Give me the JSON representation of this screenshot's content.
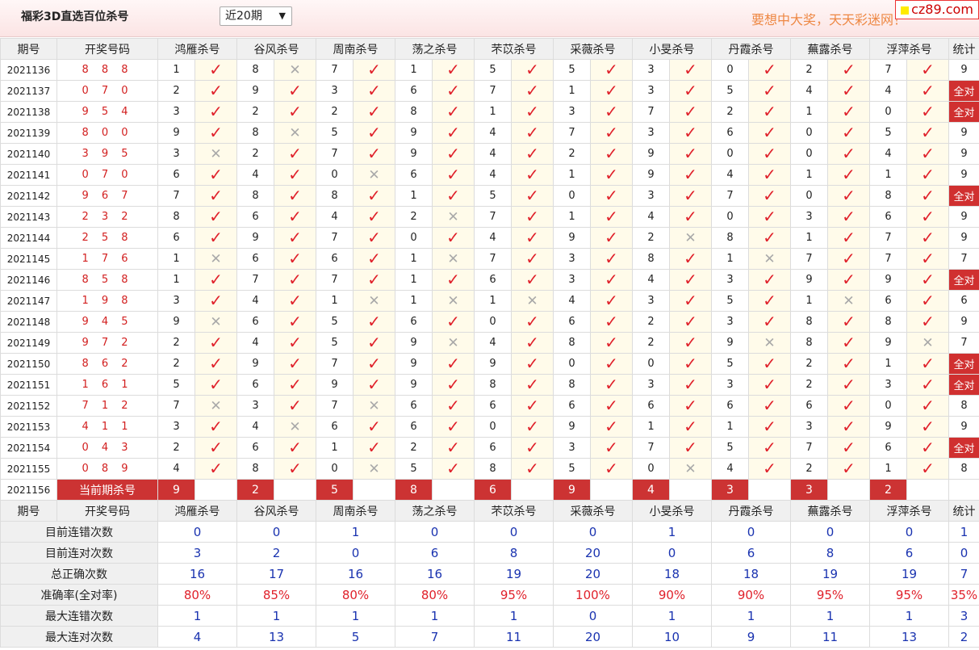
{
  "header": {
    "title": "福彩3D直选百位杀号",
    "period_select": "近20期",
    "slogan": "要想中大奖，天天彩迷网！",
    "logo": "cz89.com"
  },
  "columns": {
    "issue": "期号",
    "numbers": "开奖号码",
    "experts": [
      "鸿雁杀号",
      "谷风杀号",
      "周南杀号",
      "荡之杀号",
      "芣苡杀号",
      "采薇杀号",
      "小旻杀号",
      "丹霞杀号",
      "蕪露杀号",
      "浮萍杀号"
    ],
    "stat": "统计"
  },
  "rows": [
    {
      "issue": "2021136",
      "numbers": "8 8 8",
      "kills": [
        "1",
        "8",
        "7",
        "1",
        "5",
        "5",
        "3",
        "0",
        "2",
        "7"
      ],
      "results": [
        "ok",
        "x",
        "ok",
        "ok",
        "ok",
        "ok",
        "ok",
        "ok",
        "ok",
        "ok"
      ],
      "stat": "9"
    },
    {
      "issue": "2021137",
      "numbers": "0 7 0",
      "kills": [
        "2",
        "9",
        "3",
        "6",
        "7",
        "1",
        "3",
        "5",
        "4",
        "4"
      ],
      "results": [
        "ok",
        "ok",
        "ok",
        "ok",
        "ok",
        "ok",
        "ok",
        "ok",
        "ok",
        "ok"
      ],
      "stat": "全对"
    },
    {
      "issue": "2021138",
      "numbers": "9 5 4",
      "kills": [
        "3",
        "2",
        "2",
        "8",
        "1",
        "3",
        "7",
        "2",
        "1",
        "0"
      ],
      "results": [
        "ok",
        "ok",
        "ok",
        "ok",
        "ok",
        "ok",
        "ok",
        "ok",
        "ok",
        "ok"
      ],
      "stat": "全对"
    },
    {
      "issue": "2021139",
      "numbers": "8 0 0",
      "kills": [
        "9",
        "8",
        "5",
        "9",
        "4",
        "7",
        "3",
        "6",
        "0",
        "5"
      ],
      "results": [
        "ok",
        "x",
        "ok",
        "ok",
        "ok",
        "ok",
        "ok",
        "ok",
        "ok",
        "ok"
      ],
      "stat": "9"
    },
    {
      "issue": "2021140",
      "numbers": "3 9 5",
      "kills": [
        "3",
        "2",
        "7",
        "9",
        "4",
        "2",
        "9",
        "0",
        "0",
        "4"
      ],
      "results": [
        "x",
        "ok",
        "ok",
        "ok",
        "ok",
        "ok",
        "ok",
        "ok",
        "ok",
        "ok"
      ],
      "stat": "9"
    },
    {
      "issue": "2021141",
      "numbers": "0 7 0",
      "kills": [
        "6",
        "4",
        "0",
        "6",
        "4",
        "1",
        "9",
        "4",
        "1",
        "1"
      ],
      "results": [
        "ok",
        "ok",
        "x",
        "ok",
        "ok",
        "ok",
        "ok",
        "ok",
        "ok",
        "ok"
      ],
      "stat": "9"
    },
    {
      "issue": "2021142",
      "numbers": "9 6 7",
      "kills": [
        "7",
        "8",
        "8",
        "1",
        "5",
        "0",
        "3",
        "7",
        "0",
        "8"
      ],
      "results": [
        "ok",
        "ok",
        "ok",
        "ok",
        "ok",
        "ok",
        "ok",
        "ok",
        "ok",
        "ok"
      ],
      "stat": "全对"
    },
    {
      "issue": "2021143",
      "numbers": "2 3 2",
      "kills": [
        "8",
        "6",
        "4",
        "2",
        "7",
        "1",
        "4",
        "0",
        "3",
        "6"
      ],
      "results": [
        "ok",
        "ok",
        "ok",
        "x",
        "ok",
        "ok",
        "ok",
        "ok",
        "ok",
        "ok"
      ],
      "stat": "9"
    },
    {
      "issue": "2021144",
      "numbers": "2 5 8",
      "kills": [
        "6",
        "9",
        "7",
        "0",
        "4",
        "9",
        "2",
        "8",
        "1",
        "7"
      ],
      "results": [
        "ok",
        "ok",
        "ok",
        "ok",
        "ok",
        "ok",
        "x",
        "ok",
        "ok",
        "ok"
      ],
      "stat": "9"
    },
    {
      "issue": "2021145",
      "numbers": "1 7 6",
      "kills": [
        "1",
        "6",
        "6",
        "1",
        "7",
        "3",
        "8",
        "1",
        "7",
        "7"
      ],
      "results": [
        "x",
        "ok",
        "ok",
        "x",
        "ok",
        "ok",
        "ok",
        "x",
        "ok",
        "ok"
      ],
      "stat": "7"
    },
    {
      "issue": "2021146",
      "numbers": "8 5 8",
      "kills": [
        "1",
        "7",
        "7",
        "1",
        "6",
        "3",
        "4",
        "3",
        "9",
        "9"
      ],
      "results": [
        "ok",
        "ok",
        "ok",
        "ok",
        "ok",
        "ok",
        "ok",
        "ok",
        "ok",
        "ok"
      ],
      "stat": "全对"
    },
    {
      "issue": "2021147",
      "numbers": "1 9 8",
      "kills": [
        "3",
        "4",
        "1",
        "1",
        "1",
        "4",
        "3",
        "5",
        "1",
        "6"
      ],
      "results": [
        "ok",
        "ok",
        "x",
        "x",
        "x",
        "ok",
        "ok",
        "ok",
        "x",
        "ok"
      ],
      "stat": "6"
    },
    {
      "issue": "2021148",
      "numbers": "9 4 5",
      "kills": [
        "9",
        "6",
        "5",
        "6",
        "0",
        "6",
        "2",
        "3",
        "8",
        "8"
      ],
      "results": [
        "x",
        "ok",
        "ok",
        "ok",
        "ok",
        "ok",
        "ok",
        "ok",
        "ok",
        "ok"
      ],
      "stat": "9"
    },
    {
      "issue": "2021149",
      "numbers": "9 7 2",
      "kills": [
        "2",
        "4",
        "5",
        "9",
        "4",
        "8",
        "2",
        "9",
        "8",
        "9"
      ],
      "results": [
        "ok",
        "ok",
        "ok",
        "x",
        "ok",
        "ok",
        "ok",
        "x",
        "ok",
        "x"
      ],
      "stat": "7"
    },
    {
      "issue": "2021150",
      "numbers": "8 6 2",
      "kills": [
        "2",
        "9",
        "7",
        "9",
        "9",
        "0",
        "0",
        "5",
        "2",
        "1"
      ],
      "results": [
        "ok",
        "ok",
        "ok",
        "ok",
        "ok",
        "ok",
        "ok",
        "ok",
        "ok",
        "ok"
      ],
      "stat": "全对"
    },
    {
      "issue": "2021151",
      "numbers": "1 6 1",
      "kills": [
        "5",
        "6",
        "9",
        "9",
        "8",
        "8",
        "3",
        "3",
        "2",
        "3"
      ],
      "results": [
        "ok",
        "ok",
        "ok",
        "ok",
        "ok",
        "ok",
        "ok",
        "ok",
        "ok",
        "ok"
      ],
      "stat": "全对"
    },
    {
      "issue": "2021152",
      "numbers": "7 1 2",
      "kills": [
        "7",
        "3",
        "7",
        "6",
        "6",
        "6",
        "6",
        "6",
        "6",
        "0"
      ],
      "results": [
        "x",
        "ok",
        "x",
        "ok",
        "ok",
        "ok",
        "ok",
        "ok",
        "ok",
        "ok"
      ],
      "stat": "8"
    },
    {
      "issue": "2021153",
      "numbers": "4 1 1",
      "kills": [
        "3",
        "4",
        "6",
        "6",
        "0",
        "9",
        "1",
        "1",
        "3",
        "9"
      ],
      "results": [
        "ok",
        "x",
        "ok",
        "ok",
        "ok",
        "ok",
        "ok",
        "ok",
        "ok",
        "ok"
      ],
      "stat": "9"
    },
    {
      "issue": "2021154",
      "numbers": "0 4 3",
      "kills": [
        "2",
        "6",
        "1",
        "2",
        "6",
        "3",
        "7",
        "5",
        "7",
        "6"
      ],
      "results": [
        "ok",
        "ok",
        "ok",
        "ok",
        "ok",
        "ok",
        "ok",
        "ok",
        "ok",
        "ok"
      ],
      "stat": "全对"
    },
    {
      "issue": "2021155",
      "numbers": "0 8 9",
      "kills": [
        "4",
        "8",
        "0",
        "5",
        "8",
        "5",
        "0",
        "4",
        "2",
        "1"
      ],
      "results": [
        "ok",
        "ok",
        "x",
        "ok",
        "ok",
        "ok",
        "x",
        "ok",
        "ok",
        "ok"
      ],
      "stat": "8"
    }
  ],
  "current": {
    "issue": "2021156",
    "label": "当前期杀号",
    "kills": [
      "9",
      "2",
      "5",
      "8",
      "6",
      "9",
      "4",
      "3",
      "3",
      "2"
    ]
  },
  "stats": [
    {
      "label": "目前连错次数",
      "values": [
        "0",
        "0",
        "1",
        "0",
        "0",
        "0",
        "1",
        "0",
        "0",
        "0",
        "1"
      ]
    },
    {
      "label": "目前连对次数",
      "values": [
        "3",
        "2",
        "0",
        "6",
        "8",
        "20",
        "0",
        "6",
        "8",
        "6",
        "0"
      ]
    },
    {
      "label": "总正确次数",
      "values": [
        "16",
        "17",
        "16",
        "16",
        "19",
        "20",
        "18",
        "18",
        "19",
        "19",
        "7"
      ]
    },
    {
      "label": "准确率(全对率)",
      "values": [
        "80%",
        "85%",
        "80%",
        "80%",
        "95%",
        "100%",
        "90%",
        "90%",
        "95%",
        "95%",
        "35%"
      ],
      "highlight": true
    },
    {
      "label": "最大连错次数",
      "values": [
        "1",
        "1",
        "1",
        "1",
        "1",
        "0",
        "1",
        "1",
        "1",
        "1",
        "3"
      ]
    },
    {
      "label": "最大连对次数",
      "values": [
        "4",
        "13",
        "5",
        "7",
        "11",
        "20",
        "10",
        "9",
        "11",
        "13",
        "2"
      ]
    }
  ],
  "icons": {
    "ok": "check-icon",
    "x": "cross-icon"
  },
  "colors": {
    "ok": "#e0212b",
    "x": "#a9a9a9",
    "all_correct_bg": "#d03030",
    "stat_value": "#1a33b0"
  }
}
